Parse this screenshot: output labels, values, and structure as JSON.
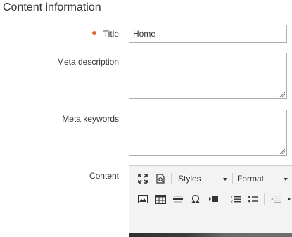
{
  "section": {
    "title": "Content information"
  },
  "fields": {
    "title": {
      "label": "Title",
      "value": "Home",
      "required": true
    },
    "meta_description": {
      "label": "Meta description",
      "value": ""
    },
    "meta_keywords": {
      "label": "Meta keywords",
      "value": ""
    },
    "content": {
      "label": "Content"
    }
  },
  "editor": {
    "toolbar_row1": [
      {
        "type": "icon",
        "name": "fullscreen-icon"
      },
      {
        "type": "icon",
        "name": "preview-icon"
      },
      {
        "type": "dropdown",
        "label": "Styles"
      },
      {
        "type": "dropdown",
        "label": "Format"
      }
    ],
    "toolbar_row2": [
      "image-icon",
      "table-icon",
      "horizontal-rule-icon",
      "special-char-icon",
      "page-break-icon",
      "numbered-list-icon",
      "bulleted-list-icon",
      "outdent-icon",
      "indent-icon"
    ],
    "styles_label": "Styles",
    "format_label": "Format"
  },
  "colors": {
    "required_dot": "#e2672f",
    "border": "#adadad",
    "toolbar_bg": "#f3f3f3"
  }
}
